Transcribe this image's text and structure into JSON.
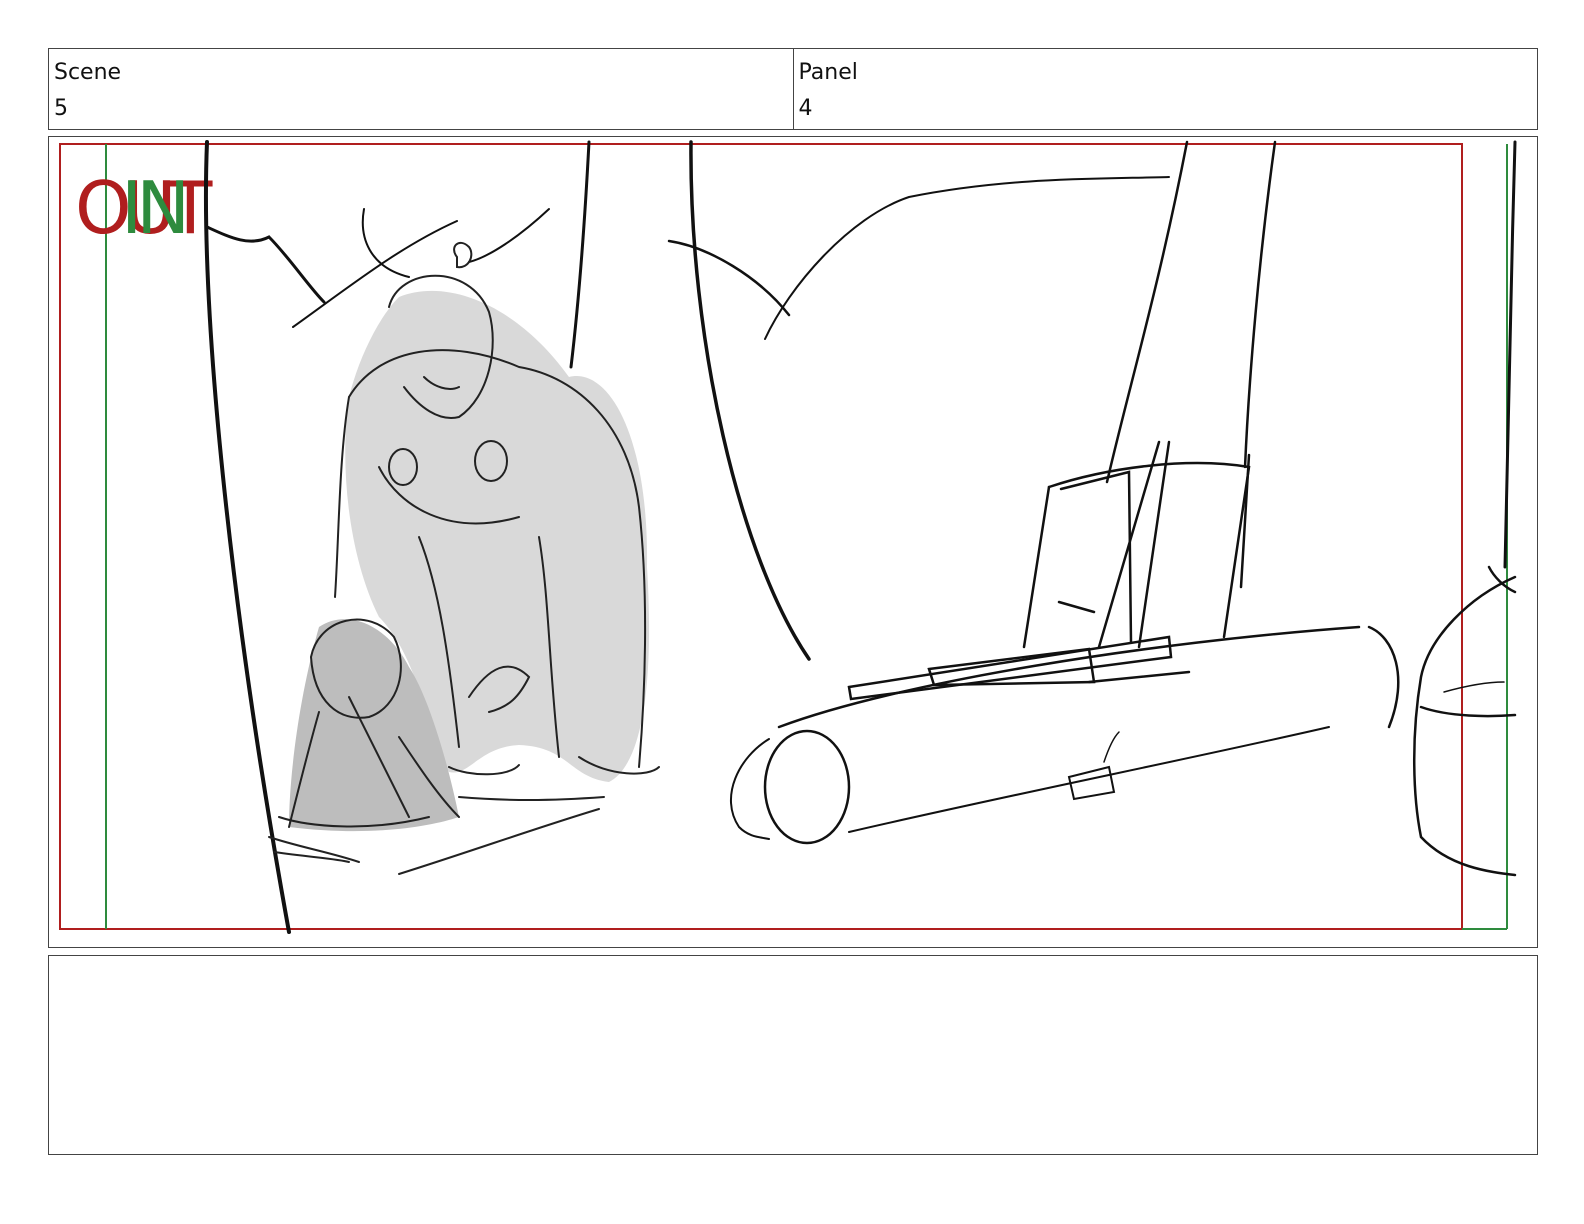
{
  "header": {
    "scene_label": "Scene",
    "scene_value": "5",
    "panel_label": "Panel",
    "panel_value": "4"
  },
  "panel": {
    "safe_area_labels": {
      "out": "OUT",
      "in": "IN"
    },
    "colors": {
      "out_frame": "#b01e1e",
      "in_frame": "#2e8b3e",
      "sketch": "#111111",
      "tone": "#d6d6d6"
    }
  },
  "notes": {
    "text": ""
  }
}
